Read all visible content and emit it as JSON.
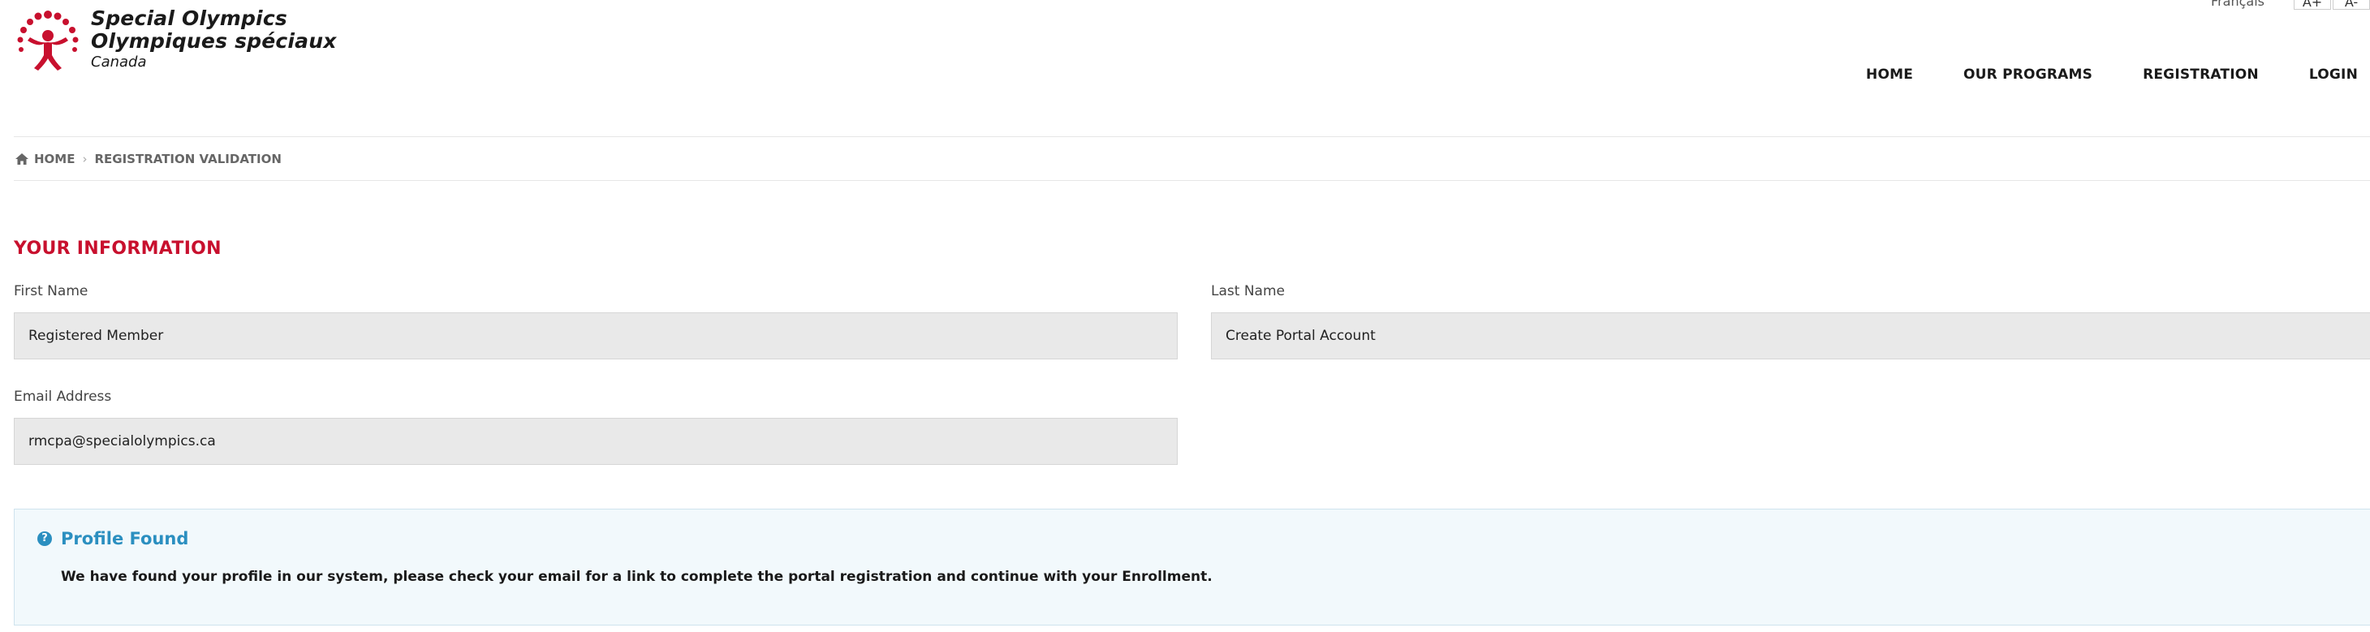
{
  "header": {
    "logo": {
      "line1": "Special Olympics",
      "line2": "Olympiques spéciaux",
      "country": "Canada"
    },
    "utility": {
      "language_link": "Français",
      "font_increase": "A+",
      "font_decrease": "A-"
    },
    "nav": {
      "items": [
        {
          "label": "HOME"
        },
        {
          "label": "OUR PROGRAMS"
        },
        {
          "label": "REGISTRATION"
        },
        {
          "label": "LOGIN"
        }
      ]
    }
  },
  "breadcrumb": {
    "home": "HOME",
    "current": "REGISTRATION VALIDATION"
  },
  "section": {
    "title": "YOUR INFORMATION"
  },
  "form": {
    "first_name": {
      "label": "First Name",
      "value": "Registered Member"
    },
    "last_name": {
      "label": "Last Name",
      "value": "Create Portal Account"
    },
    "email": {
      "label": "Email Address",
      "value": "rmcpa@specialolympics.ca"
    }
  },
  "alert": {
    "icon": "?",
    "title": "Profile Found",
    "message": "We have found your profile in our system, please check your email for a link to complete the portal registration and continue with your Enrollment."
  },
  "colors": {
    "brand_red": "#c8102e",
    "info_blue": "#2b8fc0",
    "alert_bg": "#f2f9fc",
    "field_bg": "#e9e9e9"
  }
}
